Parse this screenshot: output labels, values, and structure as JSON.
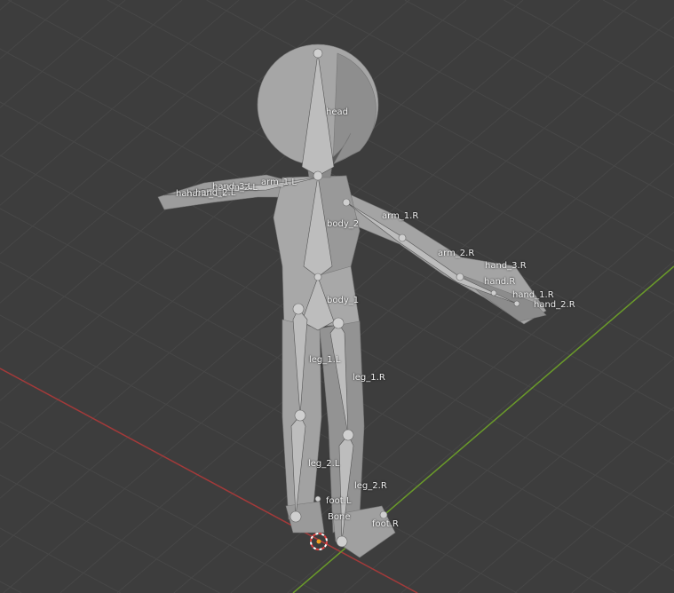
{
  "viewport": {
    "background": "#3d3d3d",
    "grid_color": "#4a4a4a",
    "x_axis_color": "#a33a3a",
    "y_axis_color": "#6a9a2a",
    "mesh_color": "#a0a0a0"
  },
  "bones": [
    {
      "id": "head",
      "label": "head"
    },
    {
      "id": "body_2",
      "label": "body_2"
    },
    {
      "id": "body_1",
      "label": "body_1"
    },
    {
      "id": "arm_1_L",
      "label": "arm_1.L"
    },
    {
      "id": "arm_2_L",
      "label": "arm_2.L"
    },
    {
      "id": "hand_3_L",
      "label": "hand_3.L"
    },
    {
      "id": "hand_L",
      "label": "hand.L"
    },
    {
      "id": "hand_1_L",
      "label": "hand_1.L"
    },
    {
      "id": "hand_2_L",
      "label": "hand_2.L"
    },
    {
      "id": "arm_1_R",
      "label": "arm_1.R"
    },
    {
      "id": "arm_2_R",
      "label": "arm_2.R"
    },
    {
      "id": "hand_3_R",
      "label": "hand_3.R"
    },
    {
      "id": "hand_R",
      "label": "hand.R"
    },
    {
      "id": "hand_1_R",
      "label": "hand_1.R"
    },
    {
      "id": "hand_2_R",
      "label": "hand_2.R"
    },
    {
      "id": "leg_1_L",
      "label": "leg_1.L"
    },
    {
      "id": "leg_1_R",
      "label": "leg_1.R"
    },
    {
      "id": "leg_2_L",
      "label": "leg_2.L"
    },
    {
      "id": "leg_2_R",
      "label": "leg_2.R"
    },
    {
      "id": "foot_L",
      "label": "foot.L"
    },
    {
      "id": "foot_R",
      "label": "foot.R"
    },
    {
      "id": "Bone",
      "label": "Bone"
    }
  ]
}
